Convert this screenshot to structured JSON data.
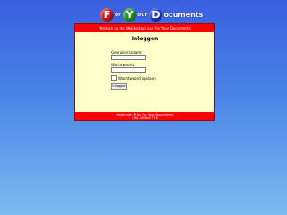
{
  "logo": {
    "letters": [
      "F",
      "Y",
      "D"
    ],
    "words": [
      "or",
      "our",
      "ocuments"
    ]
  },
  "header": {
    "welcome": "Welkom op de WebPortaal van For Your Documents"
  },
  "login": {
    "title": "Inloggen",
    "username_label": "Gebruikersnaam:",
    "username_value": "",
    "password_label": "Wachtwoord:",
    "password_value": "",
    "remember_label": "Wachtwoord opslaan",
    "remember_checked": false,
    "submit_label": "Inloggen"
  },
  "footer": {
    "line1": "Made with ♥ by For Your Documents",
    "line2": "(06) 45 864 776"
  },
  "colors": {
    "bar": "#ff0000",
    "panel": "#ffffcc",
    "background_top": "#3a5fe0",
    "background_bottom": "#7dbbee"
  },
  "icons": {
    "checkbox": "checkbox-empty-icon"
  }
}
